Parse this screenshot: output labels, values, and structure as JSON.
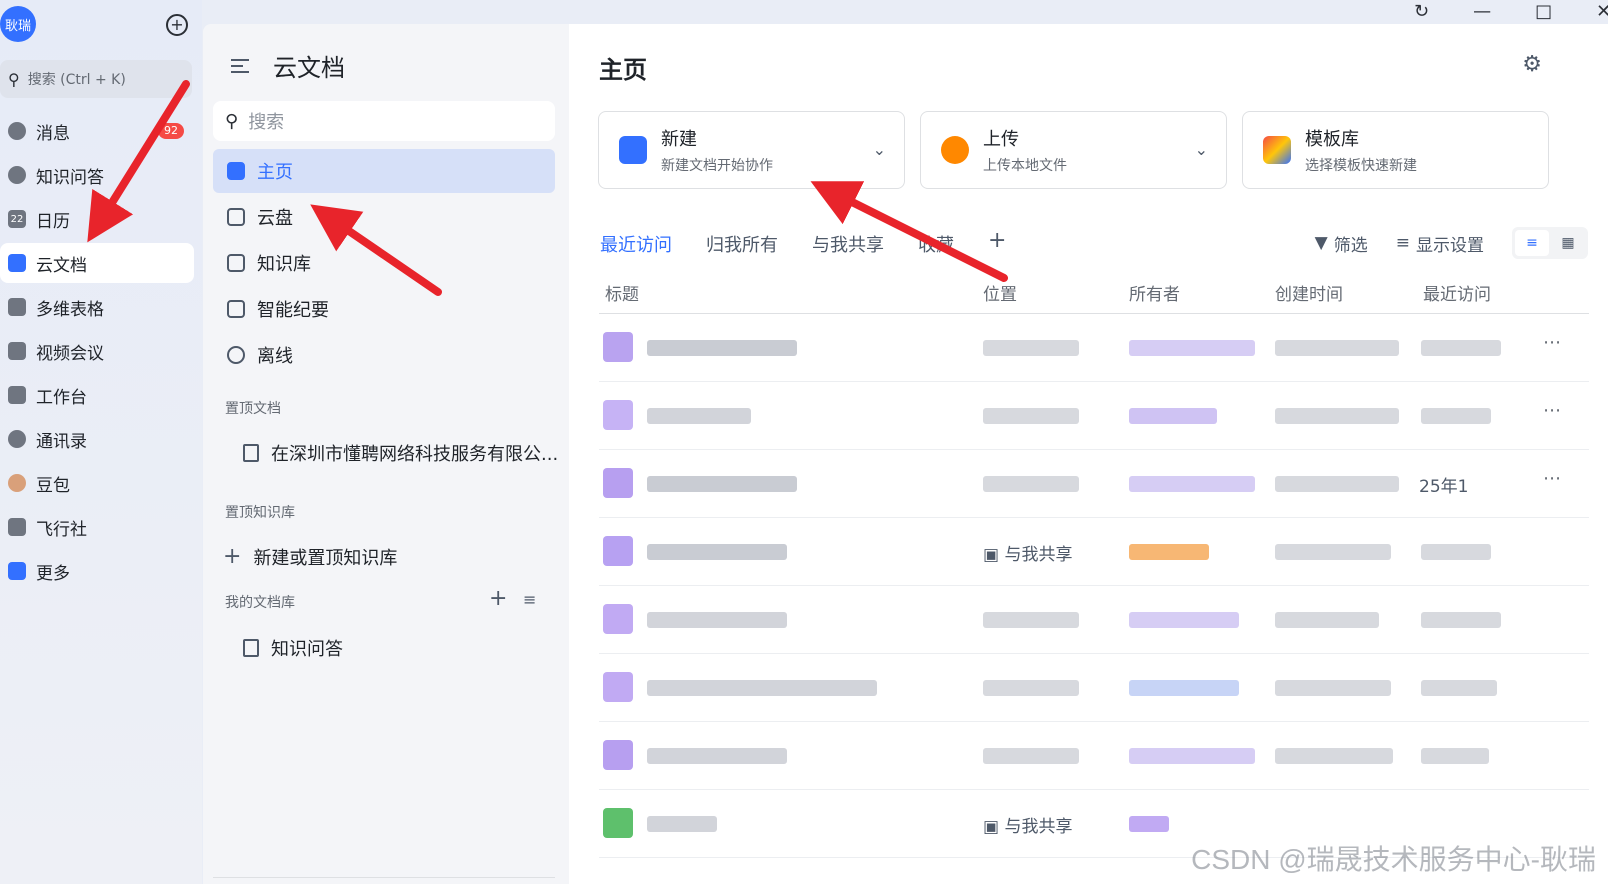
{
  "user": {
    "avatar_text": "耿瑞"
  },
  "rail": {
    "search_label": "搜索 (Ctrl + K)",
    "items": [
      {
        "label": "消息",
        "icon": "message-icon",
        "badge": "92"
      },
      {
        "label": "知识问答",
        "icon": "knowledge-qa-icon"
      },
      {
        "label": "日历",
        "icon": "calendar-icon",
        "icon_text": "22"
      },
      {
        "label": "云文档",
        "icon": "cloud-docs-icon",
        "active": true
      },
      {
        "label": "多维表格",
        "icon": "base-table-icon"
      },
      {
        "label": "视频会议",
        "icon": "video-meeting-icon"
      },
      {
        "label": "工作台",
        "icon": "workplace-icon"
      },
      {
        "label": "通讯录",
        "icon": "contacts-icon"
      },
      {
        "label": "豆包",
        "icon": "doubao-icon"
      },
      {
        "label": "飞行社",
        "icon": "flight-club-icon"
      },
      {
        "label": "更多",
        "icon": "more-apps-icon"
      }
    ]
  },
  "nav2": {
    "title": "云文档",
    "search_placeholder": "搜索",
    "items": [
      {
        "label": "主页",
        "icon": "home-icon",
        "active": true
      },
      {
        "label": "云盘",
        "icon": "cloud-drive-icon"
      },
      {
        "label": "知识库",
        "icon": "wiki-icon"
      },
      {
        "label": "智能纪要",
        "icon": "smart-minutes-icon"
      },
      {
        "label": "离线",
        "icon": "offline-icon"
      }
    ],
    "pinned_docs_label": "置顶文档",
    "pinned_doc": "在深圳市懂聘网络科技服务有限公...",
    "pinned_wiki_label": "置顶知识库",
    "new_wiki_label": "新建或置顶知识库",
    "my_library_label": "我的文档库",
    "my_library_item": "知识问答"
  },
  "main": {
    "title": "主页",
    "cards": [
      {
        "title": "新建",
        "subtitle": "新建文档开始协作",
        "icon": "new-doc-icon",
        "has_dropdown": true
      },
      {
        "title": "上传",
        "subtitle": "上传本地文件",
        "icon": "upload-cloud-icon",
        "has_dropdown": true
      },
      {
        "title": "模板库",
        "subtitle": "选择模板快速新建",
        "icon": "template-icon",
        "has_dropdown": false
      }
    ],
    "tabs": [
      "最近访问",
      "归我所有",
      "与我共享",
      "收藏"
    ],
    "active_tab": "最近访问",
    "toolbar": {
      "filter": "筛选",
      "display_settings": "显示设置"
    },
    "columns": [
      "标题",
      "位置",
      "所有者",
      "创建时间",
      "最近访问"
    ],
    "row_texts": {
      "row3_last": "25年1",
      "row4_loc": "与我共享",
      "row8_loc": "与我共享"
    }
  },
  "watermark": "CSDN @瑞晟技术服务中心-耿瑞"
}
